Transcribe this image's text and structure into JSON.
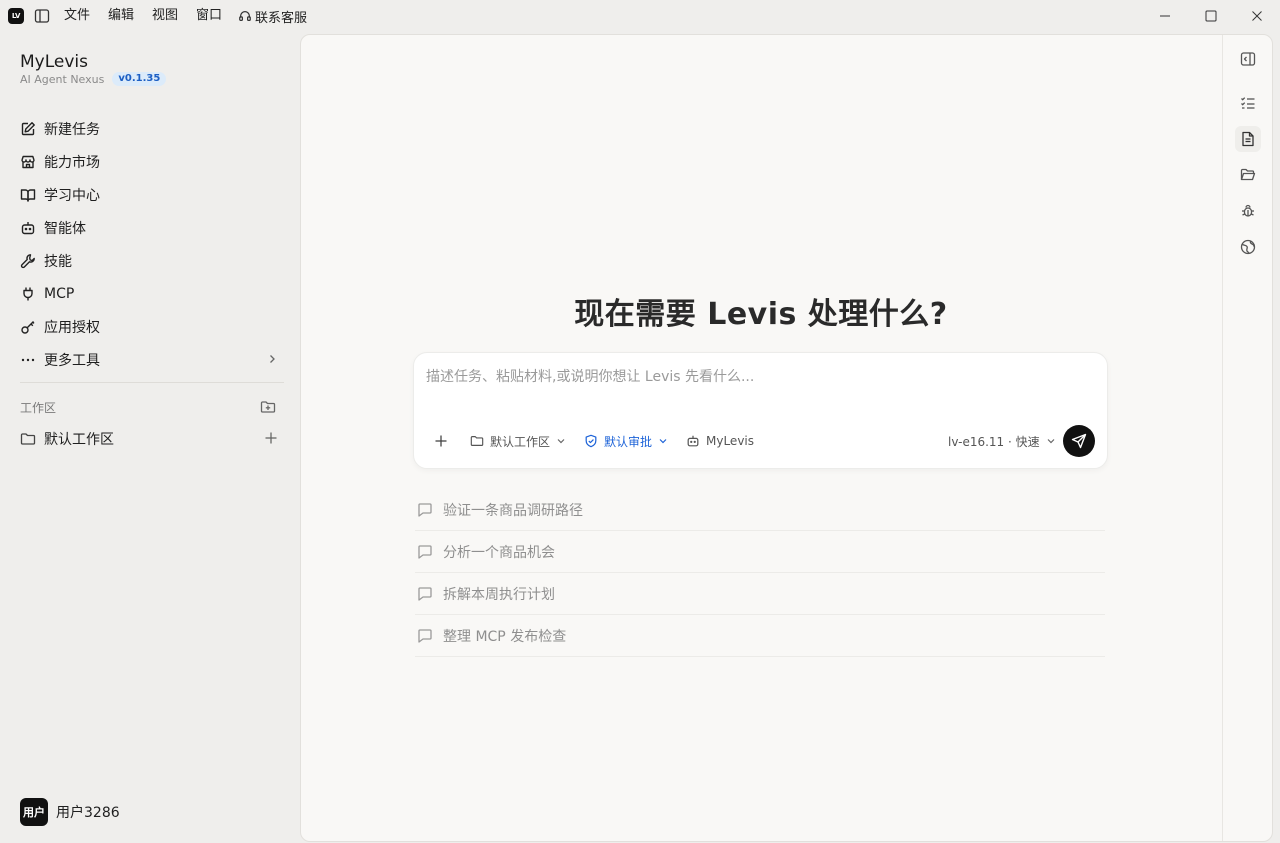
{
  "titlebar": {
    "logo_text": "LV",
    "menu": [
      "文件",
      "编辑",
      "视图",
      "窗口"
    ],
    "support_label": "联系客服"
  },
  "sidebar": {
    "brand_name": "MyLevis",
    "brand_subtitle": "AI Agent Nexus",
    "version": "v0.1.35",
    "nav": [
      {
        "label": "新建任务",
        "icon": "edit-icon"
      },
      {
        "label": "能力市场",
        "icon": "store-icon"
      },
      {
        "label": "学习中心",
        "icon": "book-icon"
      },
      {
        "label": "智能体",
        "icon": "bot-icon"
      },
      {
        "label": "技能",
        "icon": "wrench-icon"
      },
      {
        "label": "MCP",
        "icon": "plug-icon"
      },
      {
        "label": "应用授权",
        "icon": "key-icon"
      },
      {
        "label": "更多工具",
        "icon": "more-icon"
      }
    ],
    "workspace_section_title": "工作区",
    "workspaces": [
      {
        "label": "默认工作区"
      }
    ],
    "user": {
      "avatar_text": "用户",
      "name": "用户3286"
    }
  },
  "main": {
    "heading": "现在需要 Levis 处理什么?",
    "composer": {
      "placeholder": "描述任务、粘贴材料,或说明你想让 Levis 先看什么...",
      "value": "",
      "workspace_label": "默认工作区",
      "approval_label": "默认审批",
      "agent_label": "MyLevis",
      "model_label": "lv-e16.11 · 快速"
    },
    "suggestions": [
      "验证一条商品调研路径",
      "分析一个商品机会",
      "拆解本周执行计划",
      "整理 MCP 发布检查"
    ]
  },
  "colors": {
    "accent_blue": "#1d63d8",
    "badge_bg": "#dcebfa",
    "send_button": "#111111"
  }
}
